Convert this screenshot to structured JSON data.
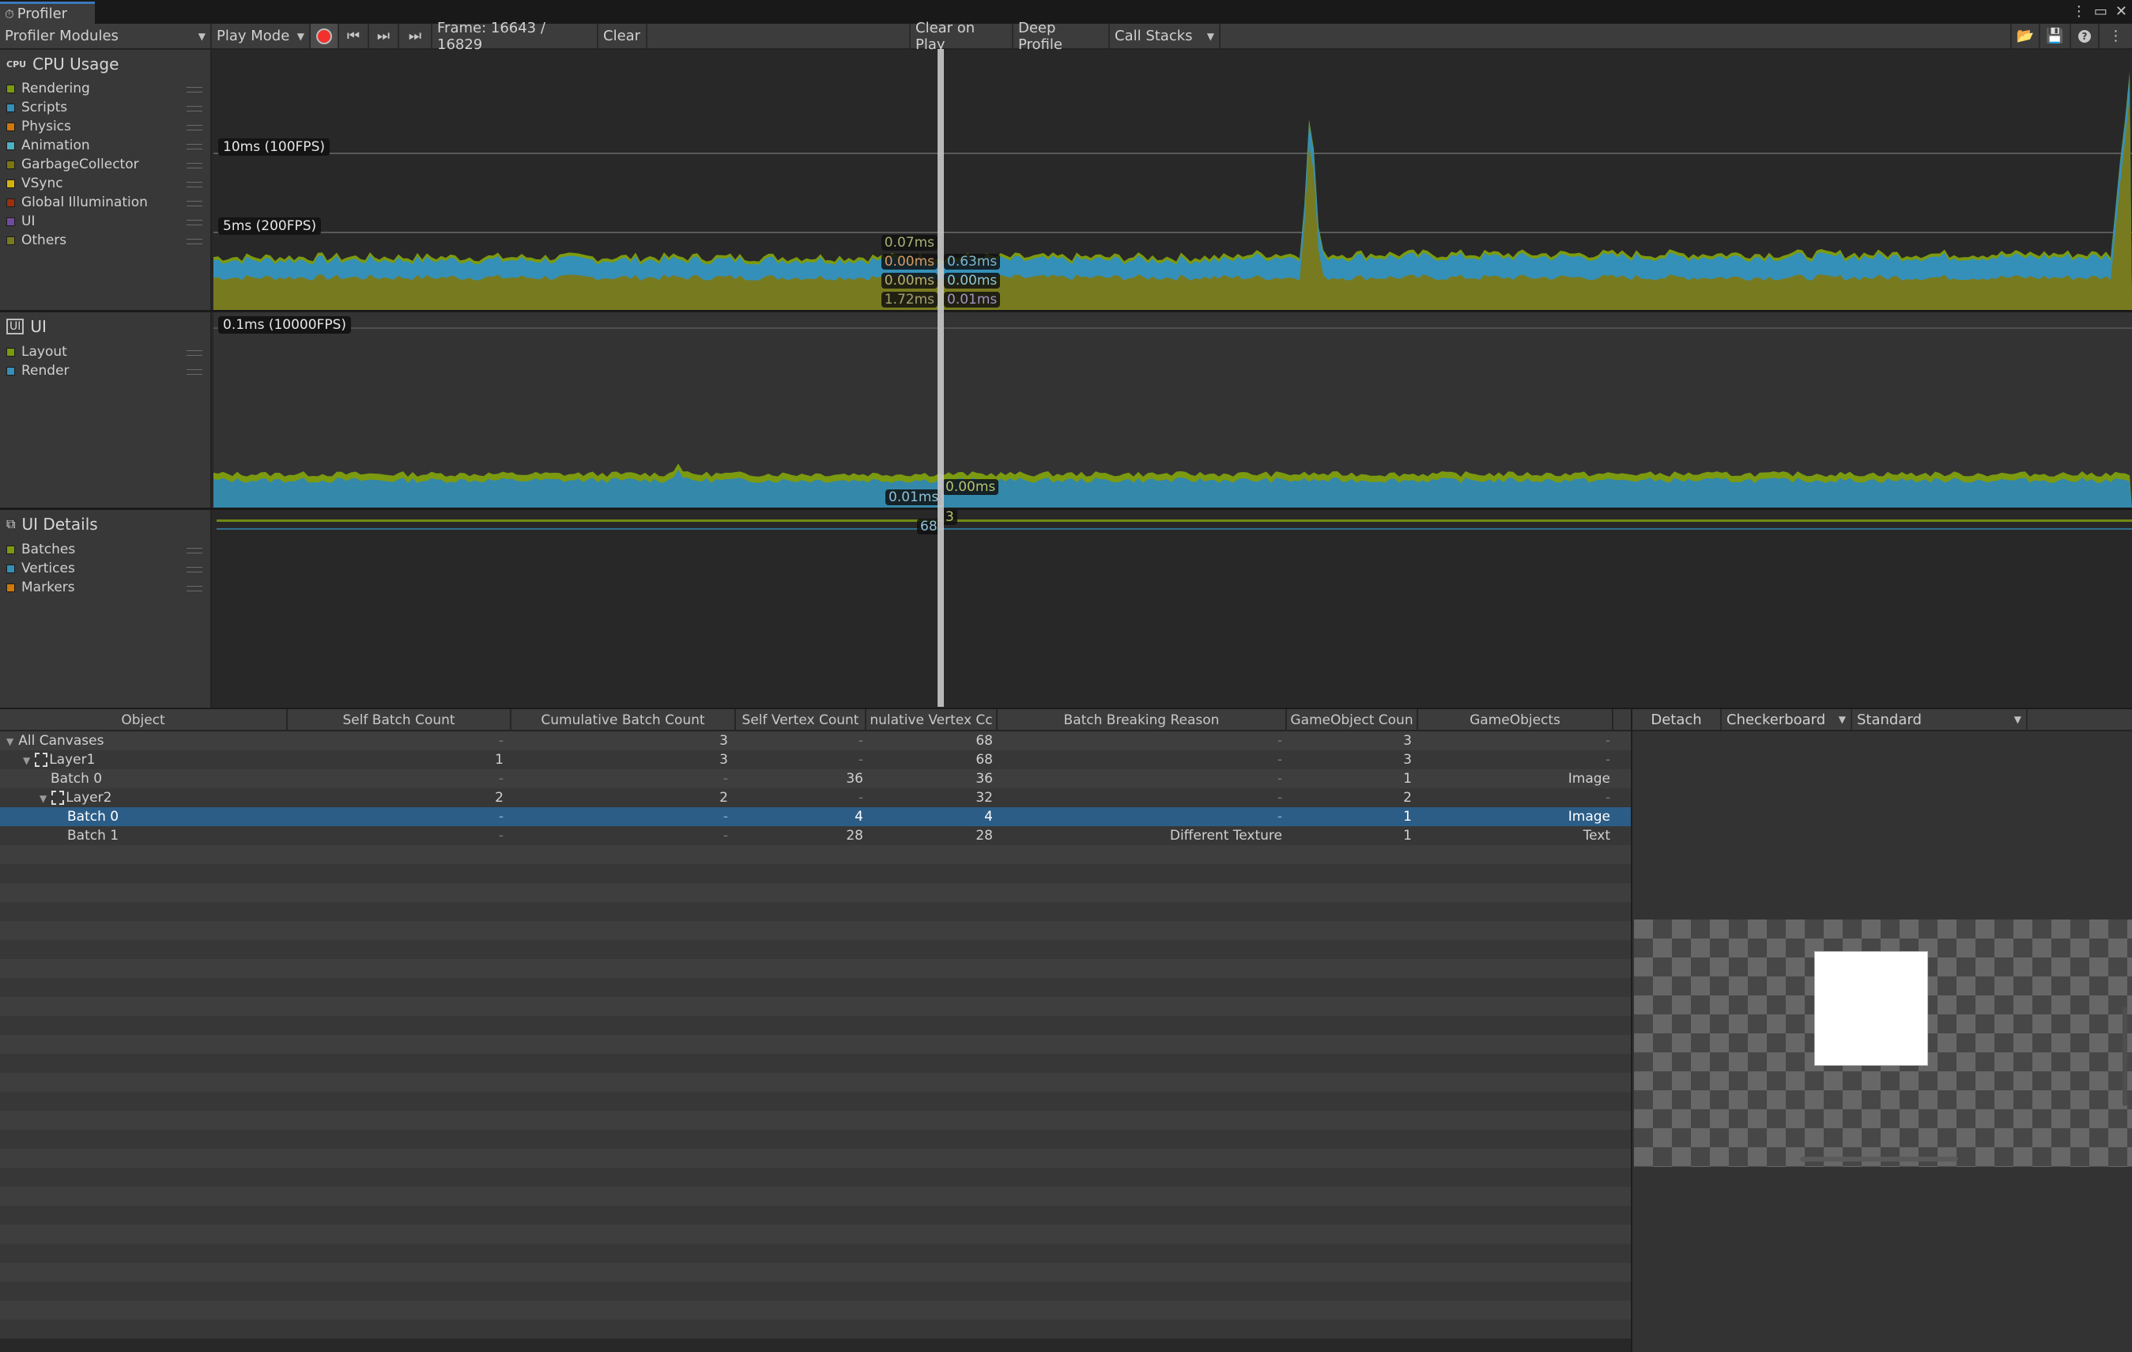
{
  "window": {
    "tab_title": "Profiler",
    "profiler_icon": "profiler-icon",
    "more_icon": "kebab-menu-icon",
    "maximize_icon": "maximize-icon",
    "close_icon": "close-icon"
  },
  "toolbar": {
    "modules_dropdown": "Profiler Modules",
    "target_dropdown": "Play Mode",
    "record_icon": "record-icon",
    "prev_frame_icon": "previous-frame-icon",
    "next_frame_icon": "next-frame-icon",
    "current_frame_icon": "current-frame-icon",
    "frame_label": "Frame: 16643 / 16829",
    "clear": "Clear",
    "clear_on_play": "Clear on Play",
    "deep_profile": "Deep Profile",
    "call_stacks": "Call Stacks",
    "load_icon": "load-icon",
    "save_icon": "save-icon",
    "help_icon": "help-icon",
    "options_icon": "kebab-menu-icon"
  },
  "modules": {
    "cpu": {
      "title": "CPU Usage",
      "icon": "cpu-icon",
      "legend": [
        {
          "label": "Rendering",
          "color": "#7c9a10"
        },
        {
          "label": "Scripts",
          "color": "#3490b8"
        },
        {
          "label": "Physics",
          "color": "#d0780a"
        },
        {
          "label": "Animation",
          "color": "#4cb2c0"
        },
        {
          "label": "GarbageCollector",
          "color": "#7b7612"
        },
        {
          "label": "VSync",
          "color": "#d4b20c"
        },
        {
          "label": "Global Illumination",
          "color": "#9c2f0c"
        },
        {
          "label": "UI",
          "color": "#6f4ba0"
        },
        {
          "label": "Others",
          "color": "#787a20"
        }
      ],
      "gridlines": [
        "10ms (100FPS)",
        "5ms (200FPS)"
      ],
      "cursor_values_left": [
        {
          "text": "0.07ms",
          "color": "#a8b070"
        },
        {
          "text": "0.00ms",
          "color": "#d29a6a"
        },
        {
          "text": "0.00ms",
          "color": "#b8b070"
        },
        {
          "text": "1.72ms",
          "color": "#a6a070"
        }
      ],
      "cursor_values_right": [
        {
          "text": "0.63ms",
          "color": "#7fb6cc"
        },
        {
          "text": "0.00ms",
          "color": "#8ec6d0"
        },
        {
          "text": "0.01ms",
          "color": "#a294c0"
        }
      ]
    },
    "ui": {
      "title": "UI",
      "icon": "ui-module-icon",
      "legend": [
        {
          "label": "Layout",
          "color": "#7c9a10"
        },
        {
          "label": "Render",
          "color": "#3490b8"
        }
      ],
      "gridline": "0.1ms (10000FPS)",
      "cursor_value_left": "0.01ms",
      "cursor_value_right": "0.00ms"
    },
    "ui_details": {
      "title": "UI Details",
      "icon": "ui-details-icon",
      "legend": [
        {
          "label": "Batches",
          "color": "#7c9a10"
        },
        {
          "label": "Vertices",
          "color": "#3490b8"
        },
        {
          "label": "Markers",
          "color": "#d0780a"
        }
      ],
      "cursor_value_vertices": "68",
      "cursor_value_batches": "3"
    }
  },
  "table": {
    "columns": [
      "Object",
      "Self Batch Count",
      "Cumulative Batch Count",
      "Self Vertex Count",
      "nulative Vertex Cc",
      "Batch Breaking Reason",
      "GameObject Coun",
      "GameObjects"
    ],
    "rows": [
      {
        "name": "All Canvases",
        "depth": 0,
        "expanded": true,
        "canvas_icon": false,
        "self_batch": "-",
        "cum_batch": "3",
        "self_vertex": "-",
        "cum_vertex": "68",
        "reason": "-",
        "go_count": "3",
        "gameobjects": "-",
        "selected": false
      },
      {
        "name": "Layer1",
        "depth": 1,
        "expanded": true,
        "canvas_icon": true,
        "self_batch": "1",
        "cum_batch": "3",
        "self_vertex": "-",
        "cum_vertex": "68",
        "reason": "-",
        "go_count": "3",
        "gameobjects": "-",
        "selected": false
      },
      {
        "name": "Batch 0",
        "depth": 2,
        "expanded": null,
        "canvas_icon": false,
        "self_batch": "-",
        "cum_batch": "-",
        "self_vertex": "36",
        "cum_vertex": "36",
        "reason": "-",
        "go_count": "1",
        "gameobjects": "Image",
        "selected": false
      },
      {
        "name": "Layer2",
        "depth": 2,
        "expanded": true,
        "canvas_icon": true,
        "self_batch": "2",
        "cum_batch": "2",
        "self_vertex": "-",
        "cum_vertex": "32",
        "reason": "-",
        "go_count": "2",
        "gameobjects": "-",
        "selected": false
      },
      {
        "name": "Batch 0",
        "depth": 3,
        "expanded": null,
        "canvas_icon": false,
        "self_batch": "-",
        "cum_batch": "-",
        "self_vertex": "4",
        "cum_vertex": "4",
        "reason": "-",
        "go_count": "1",
        "gameobjects": "Image",
        "selected": true
      },
      {
        "name": "Batch 1",
        "depth": 3,
        "expanded": null,
        "canvas_icon": false,
        "self_batch": "-",
        "cum_batch": "-",
        "self_vertex": "28",
        "cum_vertex": "28",
        "reason": "Different Texture",
        "go_count": "1",
        "gameobjects": "Text",
        "selected": false
      }
    ]
  },
  "preview": {
    "detach": "Detach",
    "background_dropdown": "Checkerboard",
    "mode_dropdown": "Standard"
  }
}
